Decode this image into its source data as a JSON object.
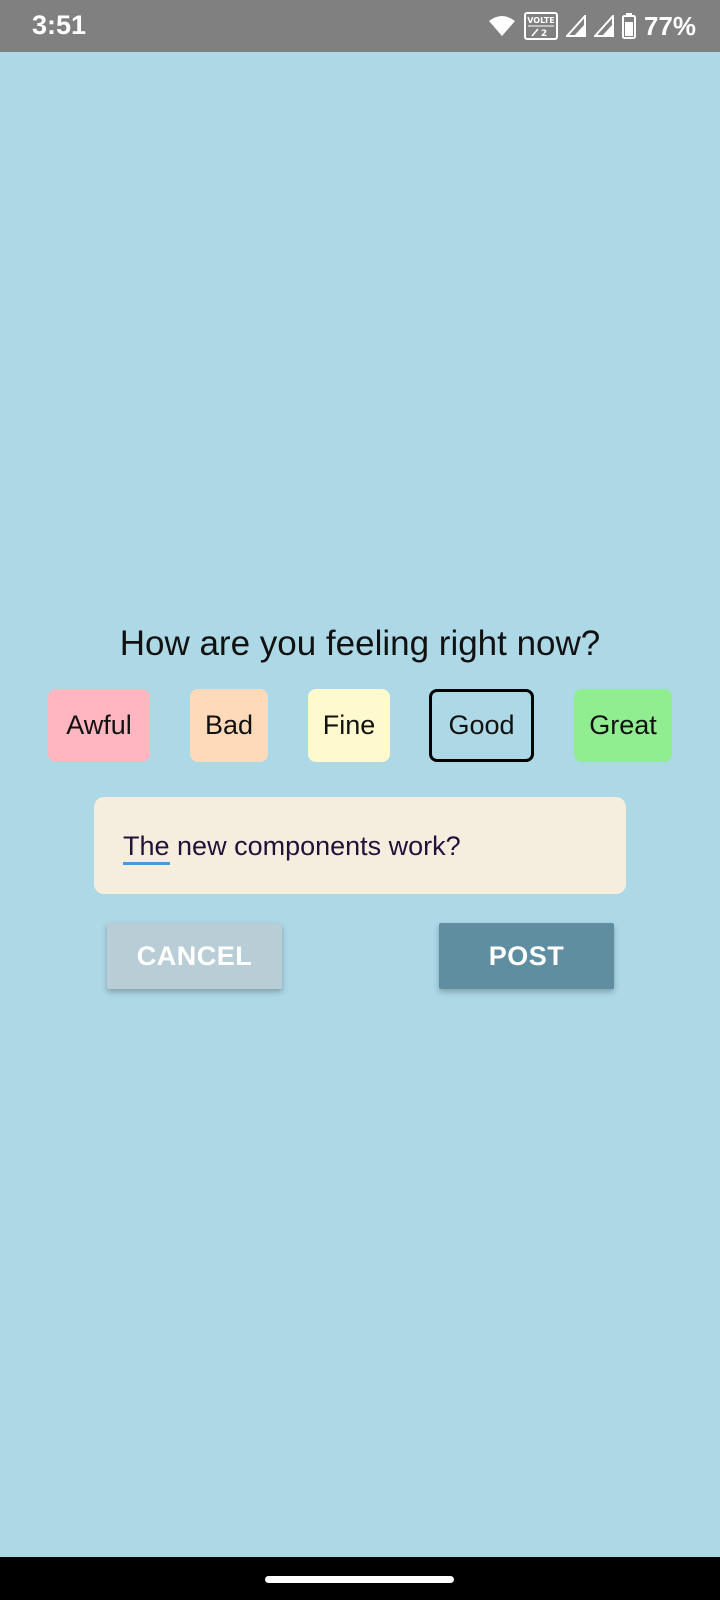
{
  "status_bar": {
    "time": "3:51",
    "battery": "77%",
    "volte_label": "VOLTE",
    "volte_sub": "2",
    "icons": [
      "wifi-icon",
      "volte-icon",
      "signal-icon",
      "signal-icon",
      "battery-icon"
    ]
  },
  "prompt": {
    "question": "How are you feeling right now?"
  },
  "moods": [
    {
      "label": "Awful",
      "color": "#FFB6C1",
      "selected": false
    },
    {
      "label": "Bad",
      "color": "#FFDAB9",
      "selected": false
    },
    {
      "label": "Fine",
      "color": "#FFFACD",
      "selected": false
    },
    {
      "label": "Good",
      "color": "",
      "selected": true
    },
    {
      "label": "Great",
      "color": "#90EE90",
      "selected": false
    }
  ],
  "post_input": {
    "value_first_word": "The",
    "value_rest": " new components work?",
    "background": "#F5EEDE"
  },
  "actions": {
    "cancel_label": "CANCEL",
    "cancel_color": "#B8CDD6",
    "post_label": "POST",
    "post_color": "#5F8EA0"
  },
  "colors": {
    "background": "#ADD8E6",
    "status_bar": "#808080"
  }
}
